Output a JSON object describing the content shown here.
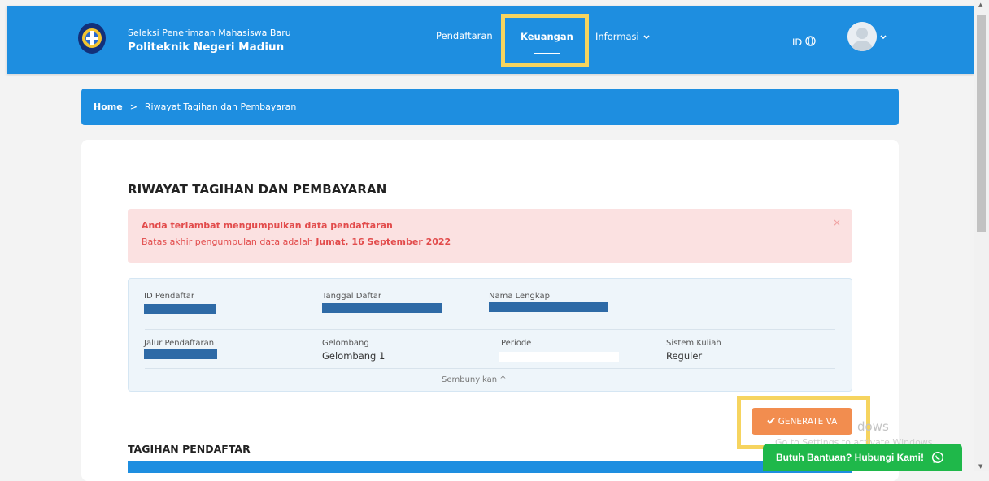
{
  "header": {
    "subtitle": "Seleksi Penerimaan Mahasiswa Baru",
    "title": "Politeknik Negeri Madiun",
    "nav": {
      "pendaftaran": "Pendaftaran",
      "keuangan": "Keuangan",
      "informasi": "Informasi"
    },
    "language": "ID"
  },
  "breadcrumb": {
    "home": "Home",
    "separator": ">",
    "current": "Riwayat Tagihan dan Pembayaran"
  },
  "page": {
    "title": "RIWAYAT TAGIHAN DAN PEMBAYARAN"
  },
  "alert": {
    "title": "Anda terlambat mengumpulkan data pendaftaran",
    "body_prefix": "Batas akhir pengumpulan data adalah",
    "deadline": "Jumat, 16 September 2022",
    "close": "×"
  },
  "registrant": {
    "labels": {
      "id": "ID Pendaftar",
      "date": "Tanggal Daftar",
      "name": "Nama Lengkap",
      "path": "Jalur Pendaftaran",
      "wave": "Gelombang",
      "period": "Periode",
      "system": "Sistem Kuliah"
    },
    "values": {
      "wave": "Gelombang 1",
      "system": "Reguler"
    },
    "toggle": "Sembunyikan ^"
  },
  "actions": {
    "generate_va": "GENERATE VA"
  },
  "watermark": {
    "line1": "dows",
    "line2": "Go to Settings to activate Windows."
  },
  "billing": {
    "section_title": "TAGIHAN PENDAFTAR"
  },
  "help": {
    "label": "Butuh Bantuan? Hubungi Kami!"
  },
  "colors": {
    "primary": "#1e8ee0",
    "alert_bg": "#fbe1e1",
    "alert_text": "#e24b4b",
    "generate_button": "#f28d4f",
    "help_button": "#1fb84a",
    "highlight": "#f6d45f"
  }
}
